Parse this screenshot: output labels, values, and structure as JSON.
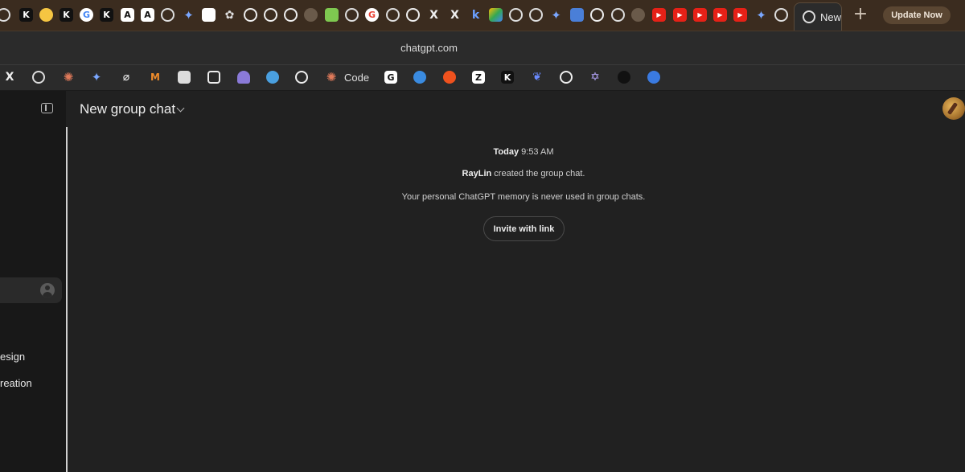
{
  "browser": {
    "active_tab_title": "New",
    "update_button": "Update Now",
    "new_tab_symbol": "+",
    "url": "chatgpt.com",
    "bookmark_label": "Code",
    "tab_icons": [
      "openai-icon",
      "kimi-icon",
      "hugging-face-icon",
      "kimi-icon",
      "google-icon",
      "kimi-icon",
      "anthropic-icon",
      "anthropic-icon",
      "perplexity-icon",
      "gemini-icon",
      "ai-app-icon",
      "network-icon",
      "github-icon",
      "github-icon",
      "github-icon",
      "telegram-icon",
      "app-icon",
      "openai-icon",
      "google-icon",
      "openai-icon",
      "circle-c-icon",
      "x-icon",
      "x-icon",
      "k-icon",
      "drive-icon",
      "openai-icon",
      "openai-icon",
      "gemini-icon",
      "translate-icon",
      "circle-c-icon",
      "openai-icon",
      "telegram-icon",
      "youtube-icon",
      "youtube-icon",
      "youtube-icon",
      "youtube-icon",
      "youtube-icon",
      "gemini-icon",
      "openai-icon"
    ],
    "bookmarks": [
      "x-icon",
      "openai-icon",
      "claude-icon",
      "gemini-icon",
      "perplexity-icon",
      "m-icon",
      "notes-icon",
      "arrow-box-icon",
      "ghost-icon",
      "bot-icon",
      "circle-c-icon",
      "claude-icon",
      "g-icon",
      "openai-icon",
      "reddit-icon",
      "z-icon",
      "kimi-icon",
      "bird-icon",
      "perplexity-icon",
      "star-icon",
      "knot-icon",
      "orb-icon"
    ]
  },
  "sidebar": {
    "items": [
      {
        "label": "esign"
      },
      {
        "label": "reation"
      }
    ]
  },
  "header": {
    "title": "New group chat"
  },
  "chat": {
    "date_day": "Today",
    "date_time": "9:53 AM",
    "creator": "RayLin",
    "created_text": "created the group chat.",
    "notice": "Your personal ChatGPT memory is never used in group chats.",
    "invite_button": "Invite with link"
  },
  "colors": {
    "tabstrip": "#3b2c1f",
    "background": "#212121",
    "sidebar": "#181818"
  }
}
